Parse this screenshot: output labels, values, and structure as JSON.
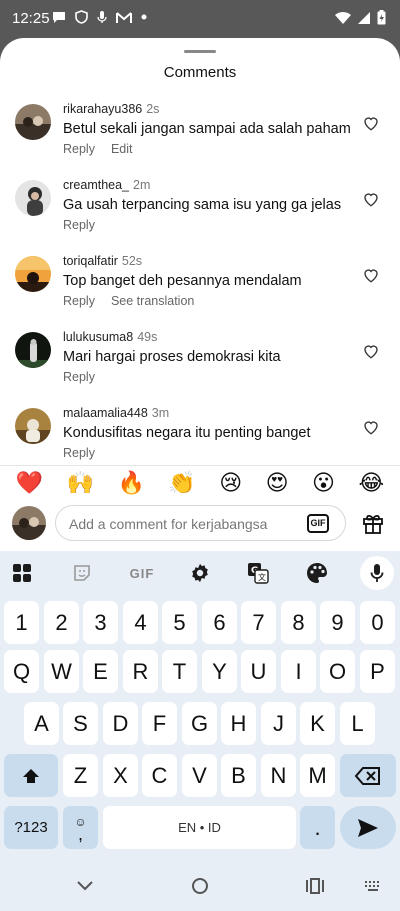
{
  "status": {
    "time": "12:25"
  },
  "sheet": {
    "title": "Comments"
  },
  "comments": [
    {
      "username": "rikarahayu386",
      "time": "2s",
      "text": "Betul sekali jangan sampai ada salah paham",
      "actions": [
        "Reply",
        "Edit"
      ]
    },
    {
      "username": "creamthea_",
      "time": "2m",
      "text": "Ga usah terpancing sama isu yang ga jelas",
      "actions": [
        "Reply"
      ]
    },
    {
      "username": "toriqalfatir",
      "time": "52s",
      "text": "Top banget deh pesannya mendalam",
      "actions": [
        "Reply",
        "See translation"
      ]
    },
    {
      "username": "lulukusuma8",
      "time": "49s",
      "text": "Mari hargai proses demokrasi kita",
      "actions": [
        "Reply"
      ]
    },
    {
      "username": "malaamalia448",
      "time": "3m",
      "text": "Kondusifitas negara itu penting banget",
      "actions": [
        "Reply"
      ]
    }
  ],
  "reactions": [
    "❤️",
    "🙌",
    "🔥",
    "👏",
    "😢",
    "😍",
    "😮",
    "😂"
  ],
  "composer": {
    "placeholder": "Add a comment for kerjabangsa",
    "gif_label": "GIF"
  },
  "keyboard": {
    "toolbar_gif": "GIF",
    "row_numbers": [
      "1",
      "2",
      "3",
      "4",
      "5",
      "6",
      "7",
      "8",
      "9",
      "0"
    ],
    "row1": [
      "Q",
      "W",
      "E",
      "R",
      "T",
      "Y",
      "U",
      "I",
      "O",
      "P"
    ],
    "row2": [
      "A",
      "S",
      "D",
      "F",
      "G",
      "H",
      "J",
      "K",
      "L"
    ],
    "row3": [
      "Z",
      "X",
      "C",
      "V",
      "B",
      "N",
      "M"
    ],
    "symbols_label": "?123",
    "emoji_label": "☺",
    "comma_label": ",",
    "space_label": "EN • ID",
    "period_label": "."
  }
}
